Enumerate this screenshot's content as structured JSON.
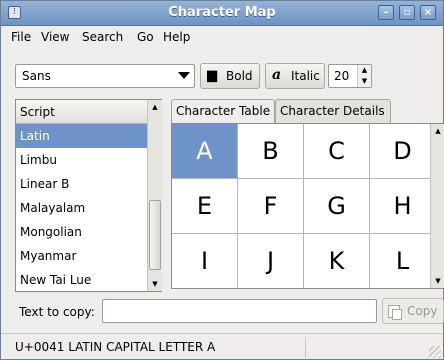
{
  "window": {
    "title": "Character Map"
  },
  "menu": {
    "file": "File",
    "view": "View",
    "search": "Search",
    "go": "Go",
    "help": "Help"
  },
  "toolbar": {
    "font_family": "Sans",
    "bold_label": "Bold",
    "italic_label": "Italic",
    "font_size": "20"
  },
  "script_list": {
    "header": "Script",
    "items": [
      "Latin",
      "Limbu",
      "Linear B",
      "Malayalam",
      "Mongolian",
      "Myanmar",
      "New Tai Lue"
    ],
    "selected": "Latin"
  },
  "tabs": {
    "character_table": "Character Table",
    "character_details": "Character Details",
    "active": "Character Table"
  },
  "character_grid": {
    "rows": [
      [
        "A",
        "B",
        "C",
        "D"
      ],
      [
        "E",
        "F",
        "G",
        "H"
      ],
      [
        "I",
        "J",
        "K",
        "L"
      ]
    ],
    "selected": "A"
  },
  "copy": {
    "label": "Text to copy:",
    "value": "",
    "button": "Copy"
  },
  "status": {
    "text": "U+0041 LATIN CAPITAL LETTER A"
  },
  "colors": {
    "selection": "#6d93c8",
    "titlebar": "#7fa2cf"
  }
}
